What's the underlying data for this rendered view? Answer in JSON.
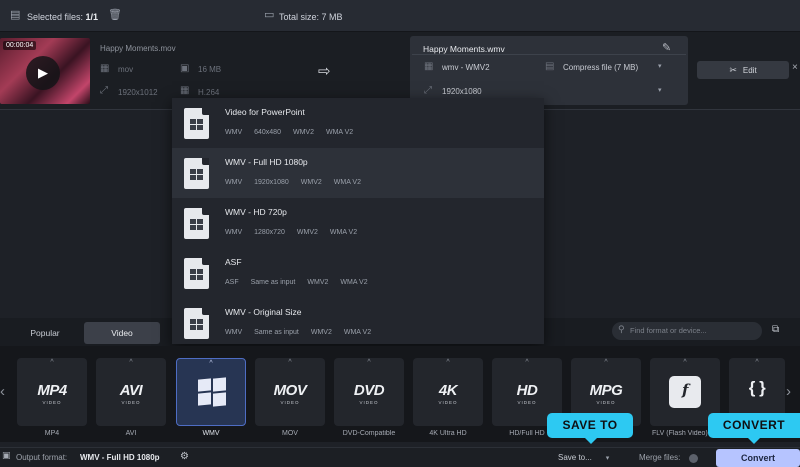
{
  "topbar": {
    "selected_label": "Selected files:",
    "selected_count": "1/1",
    "total_size": "Total size: 7 MB"
  },
  "file": {
    "duration": "00:00:04",
    "name": "Happy Moments.mov",
    "container": "mov",
    "size": "16 MB",
    "resolution": "1920x1012",
    "codec": "H.264"
  },
  "output_panel": {
    "filename": "Happy Moments.wmv",
    "format": "wmv - WMV2",
    "compress": "Compress file (7 MB)",
    "resolution": "1920x1080",
    "edit_label": "Edit"
  },
  "dropdown": {
    "items": [
      {
        "name": "Video for PowerPoint",
        "specs": [
          "WMV",
          "640x480",
          "WMV2",
          "WMA V2"
        ]
      },
      {
        "name": "WMV - Full HD 1080p",
        "specs": [
          "WMV",
          "1920x1080",
          "WMV2",
          "WMA V2"
        ]
      },
      {
        "name": "WMV - HD 720p",
        "specs": [
          "WMV",
          "1280x720",
          "WMV2",
          "WMA V2"
        ]
      },
      {
        "name": "ASF",
        "specs": [
          "ASF",
          "Same as input",
          "WMV2",
          "WMA V2"
        ]
      },
      {
        "name": "WMV - Original Size",
        "specs": [
          "WMV",
          "Same as input",
          "WMV2",
          "WMA V2"
        ]
      }
    ],
    "selected_index": 1
  },
  "tabs": [
    {
      "label": "Popular"
    },
    {
      "label": "Video"
    }
  ],
  "search": {
    "placeholder": "Find format or device..."
  },
  "formats": [
    {
      "big": "MP4",
      "sub": "VIDEO",
      "label": "MP4"
    },
    {
      "big": "AVI",
      "sub": "VIDEO",
      "label": "AVI"
    },
    {
      "big": "",
      "sub": "",
      "label": "WMV"
    },
    {
      "big": "MOV",
      "sub": "VIDEO",
      "label": "MOV"
    },
    {
      "big": "DVD",
      "sub": "VIDEO",
      "label": "DVD-Compatible"
    },
    {
      "big": "4K",
      "sub": "VIDEO",
      "label": "4K Ultra HD"
    },
    {
      "big": "HD",
      "sub": "VIDEO",
      "label": "HD/Full HD"
    },
    {
      "big": "MPG",
      "sub": "VIDEO",
      "label": "MPG"
    },
    {
      "big": "f",
      "sub": "",
      "label": "FLV (Flash Video)"
    },
    {
      "big": "{ }",
      "sub": "",
      "label": ""
    }
  ],
  "statusbar": {
    "output_label": "Output format:",
    "output_value": "WMV - Full HD 1080p",
    "save_to": "Save to...",
    "merge": "Merge files:",
    "convert": "Convert"
  },
  "callouts": {
    "save_to": "SAVE TO",
    "convert": "CONVERT"
  },
  "colors": {
    "accent": "#b6c4ff",
    "callout": "#2dc9f2",
    "selected_tile_border": "#4e6dc4"
  }
}
